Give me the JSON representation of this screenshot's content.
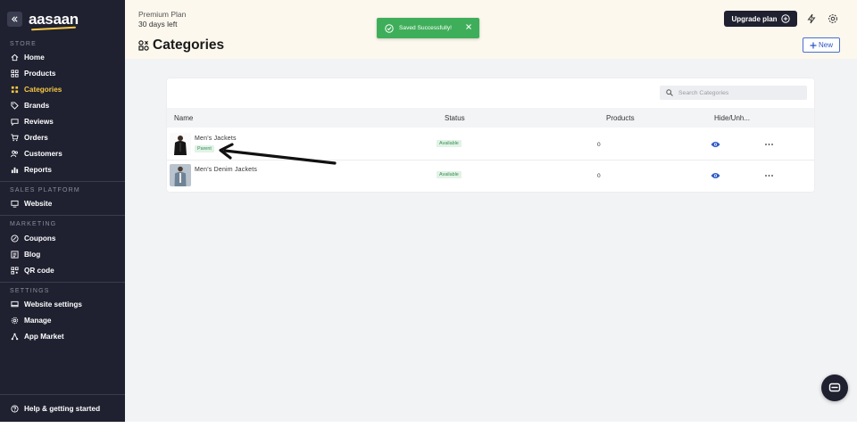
{
  "brand": {
    "logo_text": "aasaan",
    "accent_color": "#f6c744",
    "sidebar_color": "#1f2130"
  },
  "sidebar": {
    "sections": [
      {
        "title": "STORE",
        "items": [
          {
            "label": "Home",
            "icon": "home-icon"
          },
          {
            "label": "Products",
            "icon": "products-icon"
          },
          {
            "label": "Categories",
            "icon": "categories-icon",
            "active": true
          },
          {
            "label": "Brands",
            "icon": "tag-icon"
          },
          {
            "label": "Reviews",
            "icon": "review-icon"
          },
          {
            "label": "Orders",
            "icon": "cart-icon"
          },
          {
            "label": "Customers",
            "icon": "customers-icon"
          },
          {
            "label": "Reports",
            "icon": "reports-icon"
          }
        ]
      },
      {
        "title": "SALES PLATFORM",
        "items": [
          {
            "label": "Website",
            "icon": "monitor-icon"
          }
        ]
      },
      {
        "title": "MARKETING",
        "items": [
          {
            "label": "Coupons",
            "icon": "coupon-icon"
          },
          {
            "label": "Blog",
            "icon": "blog-icon"
          },
          {
            "label": "QR code",
            "icon": "qr-icon"
          }
        ]
      },
      {
        "title": "SETTINGS",
        "items": [
          {
            "label": "Website settings",
            "icon": "website-settings-icon"
          },
          {
            "label": "Manage",
            "icon": "gear-icon"
          },
          {
            "label": "App Market",
            "icon": "app-market-icon"
          }
        ]
      }
    ],
    "help_label": "Help & getting started"
  },
  "header": {
    "plan_title": "Premium Plan",
    "plan_days": "30 days left",
    "page_title": "Categories",
    "upgrade_label": "Upgrade plan",
    "new_label": "New"
  },
  "toast": {
    "message": "Saved Successfully!",
    "color": "#3fae5a"
  },
  "table": {
    "search_placeholder": "Search Categories",
    "columns": [
      "Name",
      "Status",
      "Products",
      "Hide/Unh..."
    ],
    "rows": [
      {
        "name": "Men's Jackets",
        "badge": "Parent",
        "status": "Available",
        "products": "0"
      },
      {
        "name": "Men's Denim Jackets",
        "status": "Available",
        "products": "0"
      }
    ]
  }
}
